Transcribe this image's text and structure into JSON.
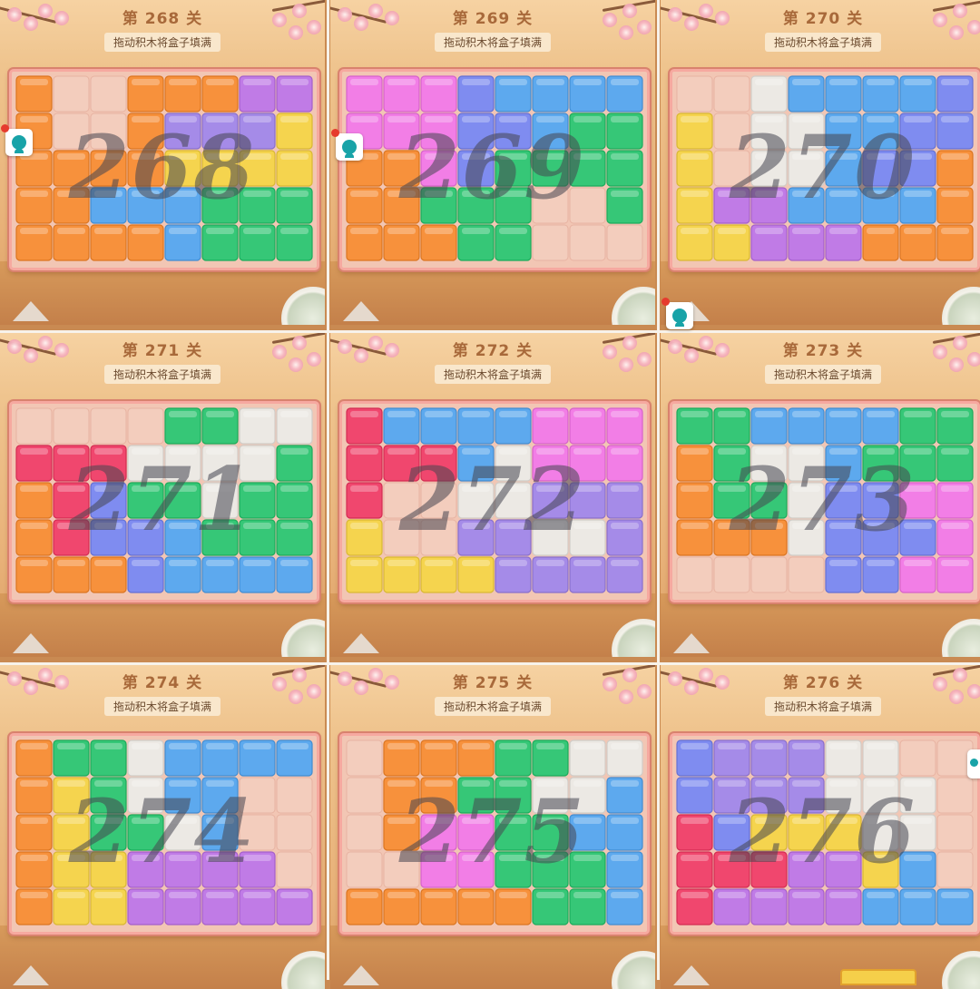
{
  "instruction_text": "拖动积木将盒子填满",
  "levels": [
    {
      "title": "第 268 关",
      "number": "268"
    },
    {
      "title": "第 269 关",
      "number": "269"
    },
    {
      "title": "第 270 关",
      "number": "270"
    },
    {
      "title": "第 271 关",
      "number": "271"
    },
    {
      "title": "第 272 关",
      "number": "272"
    },
    {
      "title": "第 273 关",
      "number": "273"
    },
    {
      "title": "第 274 关",
      "number": "274"
    },
    {
      "title": "第 275 关",
      "number": "275"
    },
    {
      "title": "第 276 关",
      "number": "276"
    }
  ],
  "palette": {
    "O": "#f7913c",
    "L": "#a58be8",
    "V": "#c07be6",
    "Y": "#f5d44e",
    "G": "#36c777",
    "B": "#5da9ee",
    "I": "#7f8cf0",
    "P": "#f27ee6",
    "R": "#f0476e",
    "W": "#ece9e4",
    "E": "#f3cdbd"
  },
  "boards": [
    [
      "OEEOOOVV",
      "OEEOLLLY",
      "OOOOYYYY",
      "OOBBBGGG",
      "OOOOBGGG"
    ],
    [
      "PPPIBBBB",
      "PPPIIBGG",
      "OOPIGGGG",
      "OOGGGEEG",
      "OOOGGEEE"
    ],
    [
      "EEWBBBBI",
      "YEWWBBII",
      "YEWWBIIO",
      "YVVBBBBO",
      "YYVVVOOO"
    ],
    [
      "EEEEGGWW",
      "RRRWWWWG",
      "ORIGGWGG",
      "ORIIBGGG",
      "OOOIBBBB"
    ],
    [
      "RBBBBPPP",
      "RRRBWPPP",
      "REEWWLLL",
      "YEELLWWL",
      "YYYYLLLL"
    ],
    [
      "GGBBBBGG",
      "OGWWBGGG",
      "OGGWIIPP",
      "OOOWIIIP",
      "EEEEIIPP"
    ],
    [
      "OGGWBBBB",
      "OYGWBBEE",
      "OYGGWBEE",
      "OYYVVVVE",
      "OYYVVVVV"
    ],
    [
      "EOOOGGWW",
      "EOOGGWWB",
      "EOPPGGBB",
      "EEPPGGGB",
      "OOOOOGGB"
    ],
    [
      "ILLLWWEE",
      "ILLLWWWE",
      "RIYYYWWE",
      "RRRVVYBE",
      "RVVVVBBB"
    ]
  ]
}
